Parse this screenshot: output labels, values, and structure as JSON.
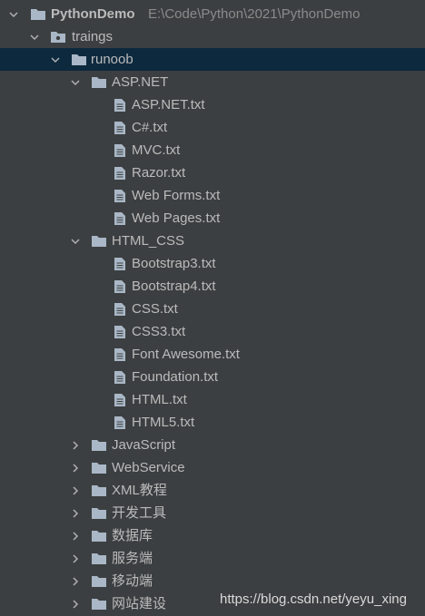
{
  "project": {
    "name": "PythonDemo",
    "path": "E:\\Code\\Python\\2021\\PythonDemo"
  },
  "tree": {
    "trainings": "traings",
    "runoob": "runoob",
    "aspnet": {
      "label": "ASP.NET",
      "files": [
        "ASP.NET.txt",
        "C#.txt",
        "MVC.txt",
        "Razor.txt",
        "Web Forms.txt",
        "Web Pages.txt"
      ]
    },
    "htmlcss": {
      "label": "HTML_CSS",
      "files": [
        "Bootstrap3.txt",
        "Bootstrap4.txt",
        "CSS.txt",
        "CSS3.txt",
        "Font Awesome.txt",
        "Foundation.txt",
        "HTML.txt",
        "HTML5.txt"
      ]
    },
    "collapsed_folders": [
      "JavaScript",
      "WebService",
      "XML教程",
      "开发工具",
      "数据库",
      "服务端",
      "移动端",
      "网站建设"
    ]
  },
  "watermark": "https://blog.csdn.net/yeyu_xing",
  "colors": {
    "background": "#3c3f41",
    "selected_row": "#0d293e",
    "text": "#bbbbbb",
    "folder_icon": "#a9b7c6"
  }
}
